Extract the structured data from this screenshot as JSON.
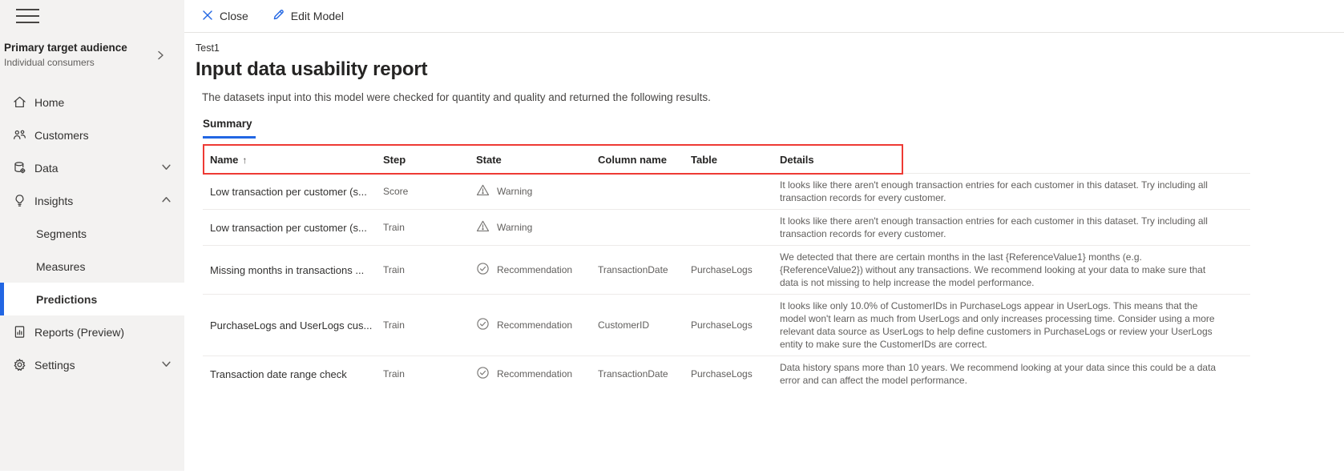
{
  "colors": {
    "accent": "#2266E3",
    "sidebar_bg": "#f3f2f1",
    "annotation_red": "#ee3a34",
    "text_primary": "#252423",
    "text_secondary": "#605e5c",
    "divider": "#edebe9"
  },
  "sidebar": {
    "hamburger_icon": "hamburger-icon",
    "audience": {
      "title": "Primary target audience",
      "subtitle": "Individual consumers",
      "chevron_icon": "chevron-right-icon"
    },
    "items": [
      {
        "label": "Home",
        "icon": "home-icon"
      },
      {
        "label": "Customers",
        "icon": "people-icon"
      },
      {
        "label": "Data",
        "icon": "database-icon",
        "chevron": "down"
      },
      {
        "label": "Insights",
        "icon": "lightbulb-icon",
        "chevron": "up"
      },
      {
        "label": "Segments",
        "indent": true
      },
      {
        "label": "Measures",
        "indent": true
      },
      {
        "label": "Predictions",
        "indent": true,
        "selected": true
      },
      {
        "label": "Reports (Preview)",
        "icon": "report-icon"
      },
      {
        "label": "Settings",
        "icon": "gear-icon",
        "chevron": "down"
      }
    ]
  },
  "command_bar": {
    "close": {
      "label": "Close",
      "icon": "close-icon"
    },
    "edit_model": {
      "label": "Edit Model",
      "icon": "pencil-icon"
    }
  },
  "header": {
    "breadcrumb": "Test1",
    "title": "Input data usability report",
    "description": "The datasets input into this model were checked for quantity and quality and returned the following results.",
    "tab": "Summary"
  },
  "table": {
    "sort_arrow": "↑",
    "columns": [
      "Name",
      "Step",
      "State",
      "Column name",
      "Table",
      "Details"
    ],
    "rows": [
      {
        "name": "Low transaction per customer (s...",
        "step": "Score",
        "state": "Warning",
        "state_type": "warning",
        "column_name": "",
        "table": "",
        "details": "It looks like there aren't enough transaction entries for each customer in this dataset. Try including all transaction records for every customer."
      },
      {
        "name": "Low transaction per customer (s...",
        "step": "Train",
        "state": "Warning",
        "state_type": "warning",
        "column_name": "",
        "table": "",
        "details": "It looks like there aren't enough transaction entries for each customer in this dataset. Try including all transaction records for every customer."
      },
      {
        "name": "Missing months in transactions ...",
        "step": "Train",
        "state": "Recommendation",
        "state_type": "recommendation",
        "column_name": "TransactionDate",
        "table": "PurchaseLogs",
        "details": "We detected that there are certain months in the last {ReferenceValue1} months (e.g. {ReferenceValue2}) without any transactions. We recommend looking at your data to make sure that data is not missing to help increase the model performance."
      },
      {
        "name": "PurchaseLogs and UserLogs cus...",
        "step": "Train",
        "state": "Recommendation",
        "state_type": "recommendation",
        "column_name": "CustomerID",
        "table": "PurchaseLogs",
        "details": "It looks like only 10.0% of CustomerIDs in PurchaseLogs appear in UserLogs. This means that the model won't learn as much from UserLogs and only increases processing time. Consider using a more relevant data source as UserLogs to help define customers in PurchaseLogs or review your UserLogs entity to make sure the CustomerIDs are correct."
      },
      {
        "name": "Transaction date range check",
        "step": "Train",
        "state": "Recommendation",
        "state_type": "recommendation",
        "column_name": "TransactionDate",
        "table": "PurchaseLogs",
        "details": "Data history spans more than 10 years. We recommend looking at your data since this could be a data error and can affect the model performance."
      }
    ]
  }
}
